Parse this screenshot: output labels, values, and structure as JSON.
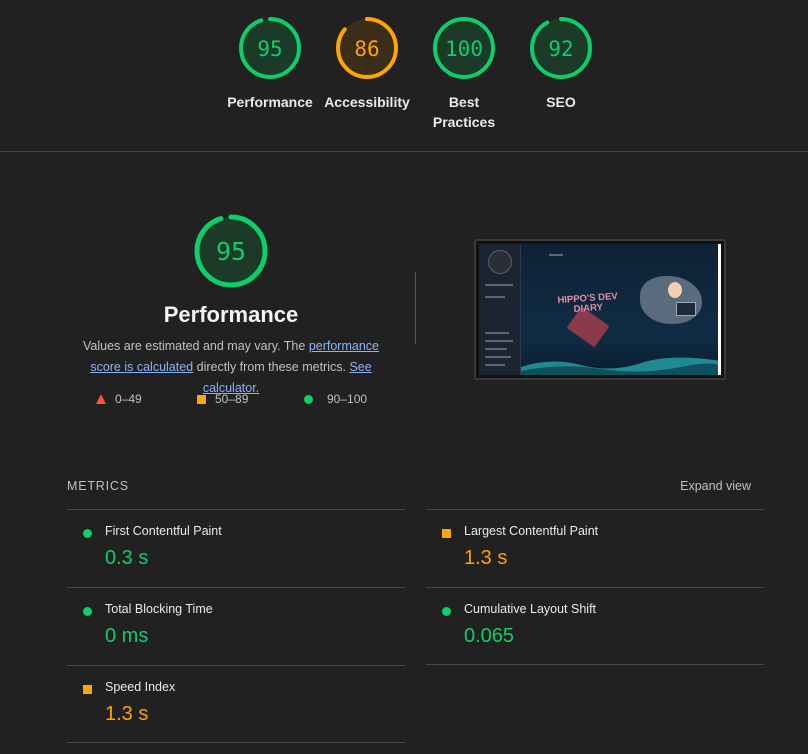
{
  "summary_gauges": [
    {
      "score": "95",
      "label": "Performance",
      "status": "pass"
    },
    {
      "score": "86",
      "label": "Accessibility",
      "status": "average"
    },
    {
      "score": "100",
      "label": "Best Practices",
      "status": "pass"
    },
    {
      "score": "92",
      "label": "SEO",
      "status": "pass"
    }
  ],
  "performance": {
    "score": "95",
    "title": "Performance",
    "desc_prefix": "Values are estimated and may vary. The ",
    "desc_link1": "performance score is calculated",
    "desc_mid": " directly from these metrics. ",
    "desc_link2": "See calculator."
  },
  "legend": {
    "fail": "0–49",
    "average": "50–89",
    "pass": "90–100"
  },
  "screenshot": {
    "hero_text": "HIPPO'S DEV DIARY"
  },
  "metrics": {
    "title": "METRICS",
    "expand_label": "Expand view",
    "items": [
      {
        "name": "First Contentful Paint",
        "value": "0.3 s",
        "status": "pass"
      },
      {
        "name": "Largest Contentful Paint",
        "value": "1.3 s",
        "status": "average"
      },
      {
        "name": "Total Blocking Time",
        "value": "0 ms",
        "status": "pass"
      },
      {
        "name": "Cumulative Layout Shift",
        "value": "0.065",
        "status": "pass"
      },
      {
        "name": "Speed Index",
        "value": "1.3 s",
        "status": "average"
      }
    ]
  },
  "colors": {
    "pass": "#0cce6b",
    "average": "#ffa400",
    "fail": "#ff4e42",
    "background": "#212121"
  }
}
